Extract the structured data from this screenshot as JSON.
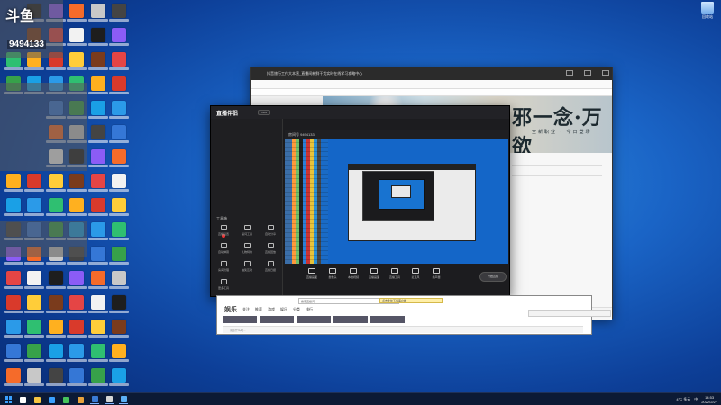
{
  "desktop": {
    "logo_text": "斗鱼",
    "room_id": "9494133",
    "recycle_bin_label": "回收站",
    "overlay_notes": "",
    "icon_colors": [
      "#f2f2f2",
      "#ffb01f",
      "#3577d6",
      "#1e1e1e",
      "#d93a2b",
      "#37a14a",
      "#8b5cf6",
      "#ffcd39",
      "#1aa0e6",
      "#f56b2a",
      "#7a3b1c",
      "#2b9ae8",
      "#c8c8c8",
      "#e54545",
      "#2fbf71",
      "#444444"
    ]
  },
  "back_window": {
    "title": "抖音旅行工作大本营_直播间新鲜干货实时在线学习攻略中心",
    "banner_text": "邪一念·万欲",
    "banner_sub": "全新职业 · 今日登场"
  },
  "live_window": {
    "brand": "直播伴侣",
    "brand_badge": "beta",
    "room_label": "房间号 9494133",
    "sidebar_title": "工具箱",
    "tools": [
      "直播设置",
      "提词工具",
      "自动分享",
      "自动弹幕",
      "礼物特效",
      "直播回放",
      "房间管理",
      "抽奖互动",
      "直播日报",
      "更多工具"
    ],
    "bottom_buttons": [
      "直播画面",
      "摄像头",
      "本地视频",
      "直播画面",
      "直播工具",
      "麦克风",
      "扬声器"
    ],
    "start_live": "开始直播"
  },
  "mid_window": {
    "brand": "娱乐",
    "search_placeholder": "搜索直播间",
    "tip": "点击此处下载客户端",
    "tabs": [
      "关注",
      "推荐",
      "游戏",
      "娱乐",
      "分类",
      "排行"
    ],
    "input_placeholder": "说点什么吧..."
  },
  "taskbar": {
    "weather": "4°C 多云",
    "time": "14:53",
    "date": "2022/2/27",
    "lang": "中"
  }
}
